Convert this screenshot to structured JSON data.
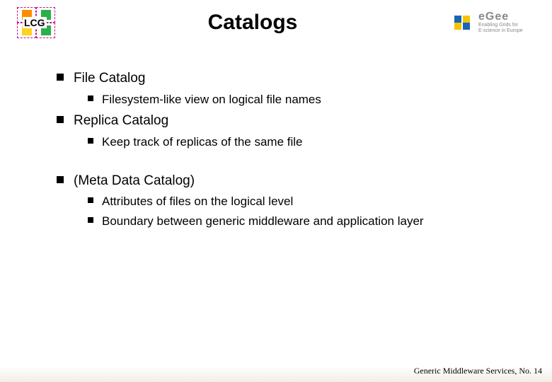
{
  "header": {
    "lcg_label": "LCG",
    "title": "Catalogs",
    "egee": {
      "brand": "eGee",
      "tagline1": "Enabling Grids for",
      "tagline2": "E-science in Europe"
    }
  },
  "bullets": [
    {
      "text": "File Catalog",
      "children": [
        {
          "text": "Filesystem-like view on logical file names"
        }
      ]
    },
    {
      "text": "Replica Catalog",
      "children": [
        {
          "text": "Keep track of replicas of the same file"
        }
      ]
    }
  ],
  "bullets2": [
    {
      "text": "(Meta Data Catalog)",
      "children": [
        {
          "text": "Attributes of files on the logical level"
        },
        {
          "text": "Boundary between generic middleware and application layer"
        }
      ]
    }
  ],
  "footer": "Generic Middleware Services, No. 14"
}
